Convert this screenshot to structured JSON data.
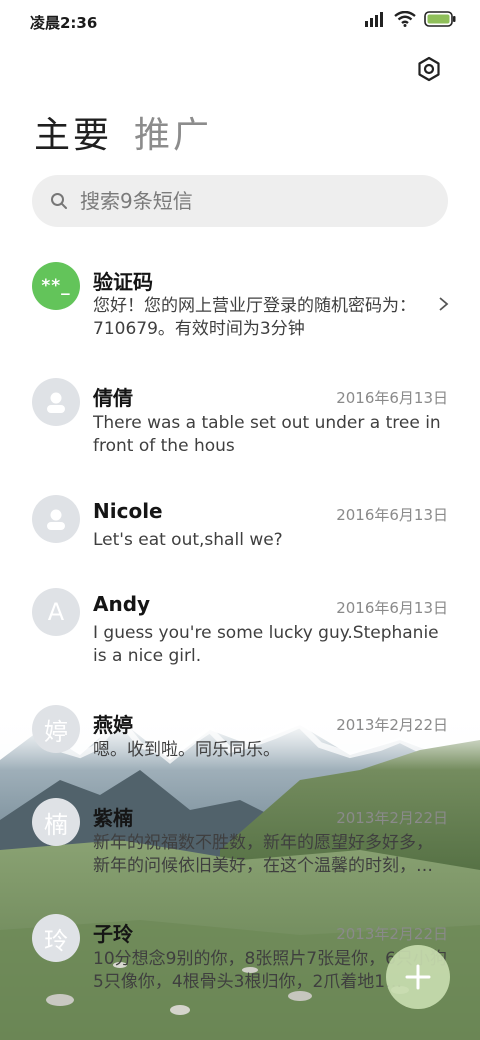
{
  "status_bar": {
    "time": "凌晨2:36"
  },
  "tabs": [
    {
      "label": "主要",
      "active": true
    },
    {
      "label": "推广",
      "active": false
    }
  ],
  "search": {
    "placeholder": "搜索9条短信",
    "value": ""
  },
  "conversations": [
    {
      "avatar": "**_",
      "name": "验证码",
      "date": "",
      "preview": "您好！您的网上营业厅登录的随机密码为：710679。有效时间为3分钟",
      "avatar_style": "green",
      "has_chevron": true
    },
    {
      "avatar": "person",
      "name": "倩倩",
      "date": "2016年6月13日",
      "preview": "There was a table set out under a tree in front of the hous"
    },
    {
      "avatar": "person",
      "name": "Nicole",
      "date": "2016年6月13日",
      "preview": "Let's eat out,shall we?"
    },
    {
      "avatar": "A",
      "name": "Andy",
      "date": "2016年6月13日",
      "preview": "I guess you're some lucky guy.Stephanie is a nice girl."
    },
    {
      "avatar": "婷",
      "name": "燕婷",
      "date": "2013年2月22日",
      "preview": "嗯。收到啦。同乐同乐。"
    },
    {
      "avatar": "楠",
      "name": "紫楠",
      "date": "2013年2月22日",
      "preview": "新年的祝福数不胜数，新年的愿望好多好多，新年的问候依旧美好，在这个温馨的时刻，…"
    },
    {
      "avatar": "玲",
      "name": "子玲",
      "date": "2013年2月22日",
      "preview": "10分想念9别的你，8张照片7张是你，6只小狗5只像你，4根骨头3根归你，2爪着地1…"
    }
  ],
  "colors": {
    "accent_green": "#63c45a",
    "avatar_gray": "#dfe2e6",
    "fab": "#c8dcaf"
  },
  "icons": [
    "signal-icon",
    "wifi-icon",
    "battery-icon",
    "settings-icon",
    "search-icon",
    "chevron-right-icon",
    "plus-icon"
  ]
}
